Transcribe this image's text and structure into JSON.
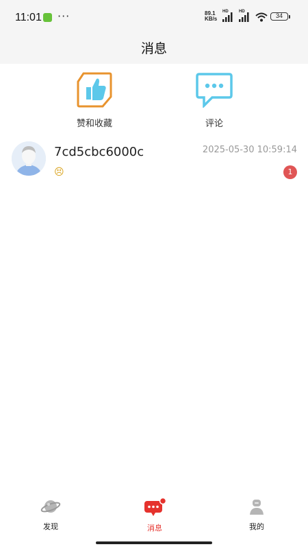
{
  "status_bar": {
    "time": "11:01",
    "net_speed_value": "89.1",
    "net_speed_unit": "KB/s",
    "hd_label": "HD",
    "battery": "34"
  },
  "header": {
    "title": "消息"
  },
  "categories": [
    {
      "label": "赞和收藏",
      "icon": "thumbs-up-icon",
      "color": "#e8932e"
    },
    {
      "label": "评论",
      "icon": "comment-icon",
      "color": "#5cc8ea"
    }
  ],
  "conversations": [
    {
      "name": "7cd5cbc6000c",
      "time": "2025-05-30 10:59:14",
      "preview": "😣",
      "unread": "1"
    }
  ],
  "tabbar": {
    "items": [
      {
        "label": "发现",
        "icon": "planet-icon",
        "active": false
      },
      {
        "label": "消息",
        "icon": "message-icon",
        "active": true
      },
      {
        "label": "我的",
        "icon": "user-icon",
        "active": false
      }
    ],
    "active_color": "#e5322d"
  }
}
